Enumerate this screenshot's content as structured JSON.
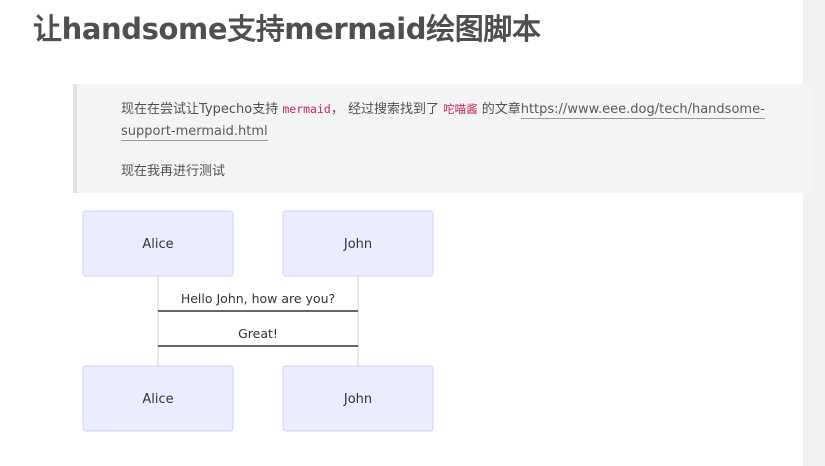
{
  "post": {
    "title": "让handsome支持mermaid绘图脚本"
  },
  "quote": {
    "line1_prefix": "现在在尝试让Typecho支持 ",
    "code1": "mermaid",
    "line1_mid": "， 经过搜索找到了 ",
    "code2": "咜喵酱",
    "line1_suffix": " 的文章",
    "link_text": "https://www.eee.dog/tech/handsome-support-mermaid.html",
    "line2": "现在我再进行测试"
  },
  "diagram": {
    "participants": [
      "Alice",
      "John"
    ],
    "messages": [
      {
        "from": "Alice",
        "to": "John",
        "text": "Hello John, how are you?"
      },
      {
        "from": "John",
        "to": "Alice",
        "text": "Great!"
      }
    ],
    "colors": {
      "actor_fill": "#ececff",
      "actor_border": "#cfd0f8",
      "lifeline": "#d6d6d6",
      "message_line": "#333333"
    }
  }
}
